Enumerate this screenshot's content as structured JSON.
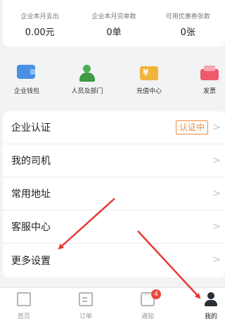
{
  "stats": [
    {
      "label": "企业本月支出",
      "value": "0.00元"
    },
    {
      "label": "企业本月完单数",
      "value": "0单"
    },
    {
      "label": "可用优惠券张数",
      "value": "0张"
    }
  ],
  "quick_actions": [
    {
      "label": "企业钱包",
      "icon": "wallet-icon"
    },
    {
      "label": "人员及部门",
      "icon": "person-icon"
    },
    {
      "label": "充值中心",
      "icon": "recharge-icon"
    },
    {
      "label": "发票",
      "icon": "invoice-icon"
    }
  ],
  "menu": [
    {
      "label": "企业认证",
      "badge": "认证中"
    },
    {
      "label": "我的司机"
    },
    {
      "label": "常用地址"
    },
    {
      "label": "客服中心"
    },
    {
      "label": "更多设置"
    }
  ],
  "tabbar": [
    {
      "label": "首页",
      "icon": "home-icon"
    },
    {
      "label": "订单",
      "icon": "order-icon"
    },
    {
      "label": "通知",
      "icon": "message-icon",
      "badge": "4"
    },
    {
      "label": "我的",
      "icon": "profile-icon",
      "active": true
    }
  ],
  "colors": {
    "accent_orange": "#f08a3c",
    "badge_red": "#e8473c",
    "annotation_red": "#e53935"
  }
}
